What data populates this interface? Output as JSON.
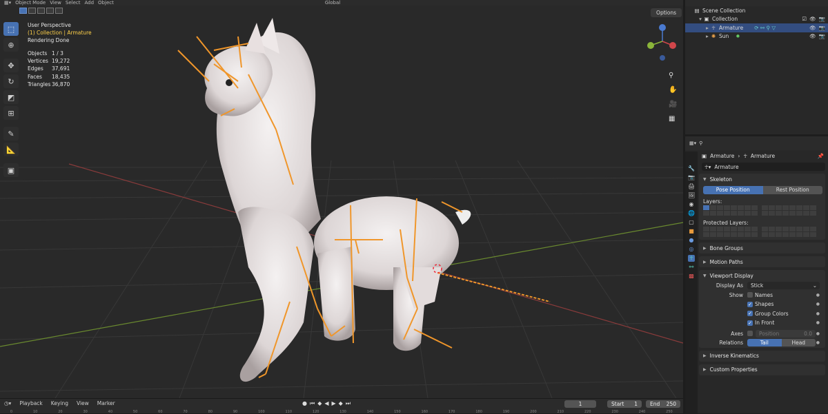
{
  "topbar": {
    "mode": "Object Mode",
    "menu": [
      "View",
      "Select",
      "Add",
      "Object"
    ],
    "orientation": "Global"
  },
  "viewport": {
    "perspective": "User Perspective",
    "collection": "(1) Collection | Armature",
    "render_status": "Rendering Done",
    "stats": [
      {
        "label": "Objects",
        "value": "1 / 3"
      },
      {
        "label": "Vertices",
        "value": "19,272"
      },
      {
        "label": "Edges",
        "value": "37,691"
      },
      {
        "label": "Faces",
        "value": "18,435"
      },
      {
        "label": "Triangles",
        "value": "36,870"
      }
    ],
    "options_label": "Options"
  },
  "toolbar_icons": [
    "select-box-icon",
    "cursor-icon",
    "move-icon",
    "rotate-icon",
    "scale-icon",
    "transform-icon",
    "annotate-icon",
    "measure-icon",
    "add-cube-icon"
  ],
  "timeline": {
    "menu": [
      "Playback",
      "Keying",
      "View",
      "Marker"
    ],
    "current_frame": "1",
    "start_label": "Start",
    "start_value": "1",
    "end_label": "End",
    "end_value": "250",
    "ruler": [
      "0",
      "10",
      "20",
      "30",
      "40",
      "50",
      "60",
      "70",
      "80",
      "90",
      "100",
      "110",
      "120",
      "130",
      "140",
      "150",
      "160",
      "170",
      "180",
      "190",
      "200",
      "210",
      "220",
      "230",
      "240",
      "250"
    ]
  },
  "outliner": {
    "scene_collection": "Scene Collection",
    "collection": "Collection",
    "items": [
      {
        "name": "Armature",
        "selected": true
      },
      {
        "name": "Sun",
        "selected": false
      }
    ]
  },
  "properties": {
    "header_object": "Armature",
    "header_data": "Armature",
    "name_field": "Armature",
    "skeleton": {
      "title": "Skeleton",
      "pose_position": "Pose Position",
      "rest_position": "Rest Position",
      "layers_label": "Layers:",
      "protected_label": "Protected Layers:"
    },
    "bone_groups": "Bone Groups",
    "motion_paths": "Motion Paths",
    "viewport_display": {
      "title": "Viewport Display",
      "display_as_label": "Display As",
      "display_as_value": "Stick",
      "show_label": "Show",
      "names": "Names",
      "shapes": "Shapes",
      "group_colors": "Group Colors",
      "in_front": "In Front",
      "axes_label": "Axes",
      "position_label": "Position",
      "position_value": "0.0",
      "relations_label": "Relations",
      "tail": "Tail",
      "head": "Head"
    },
    "inverse_kinematics": "Inverse Kinematics",
    "custom_properties": "Custom Properties"
  }
}
